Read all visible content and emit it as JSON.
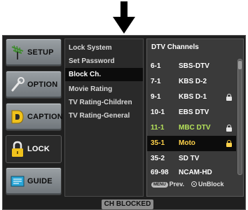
{
  "left_nav": [
    {
      "label": "SETUP",
      "icon": "antenna-icon"
    },
    {
      "label": "OPTION",
      "icon": "wrench-icon"
    },
    {
      "label": "CAPTION",
      "icon": "caption-d-icon"
    },
    {
      "label": "LOCK",
      "icon": "padlock-icon",
      "active": true
    },
    {
      "label": "GUIDE",
      "icon": "guide-book-icon"
    }
  ],
  "menu": [
    {
      "label": "Lock System"
    },
    {
      "label": "Set Password"
    },
    {
      "label": "Block Ch.",
      "selected": true
    },
    {
      "label": "Movie Rating"
    },
    {
      "label": "TV Rating-Children"
    },
    {
      "label": "TV Rating-General"
    }
  ],
  "channels": {
    "header": "DTV Channels",
    "rows": [
      {
        "num": "6-1",
        "name": "SBS-DTV",
        "locked": false
      },
      {
        "num": "7-1",
        "name": "KBS D-2",
        "locked": false
      },
      {
        "num": "9-1",
        "name": "KBS D-1",
        "locked": true
      },
      {
        "num": "10-1",
        "name": "EBS DTV",
        "locked": false
      },
      {
        "num": "11-1",
        "name": "MBC DTV",
        "locked": true,
        "highlight": "green"
      },
      {
        "num": "35-1",
        "name": "Moto",
        "locked": true,
        "selected": true
      },
      {
        "num": "35-2",
        "name": "SD TV",
        "locked": false
      },
      {
        "num": "69-98",
        "name": "NCAM-HD",
        "locked": false
      }
    ]
  },
  "legend": {
    "menu_key": "MENU",
    "prev_label": "Prev.",
    "unblock_label": "UnBlock"
  },
  "status": "CH BLOCKED",
  "colors": {
    "selected_text": "#ffd24a",
    "green_text": "#b6e35a",
    "panel_bg": "#1f1f1f"
  }
}
